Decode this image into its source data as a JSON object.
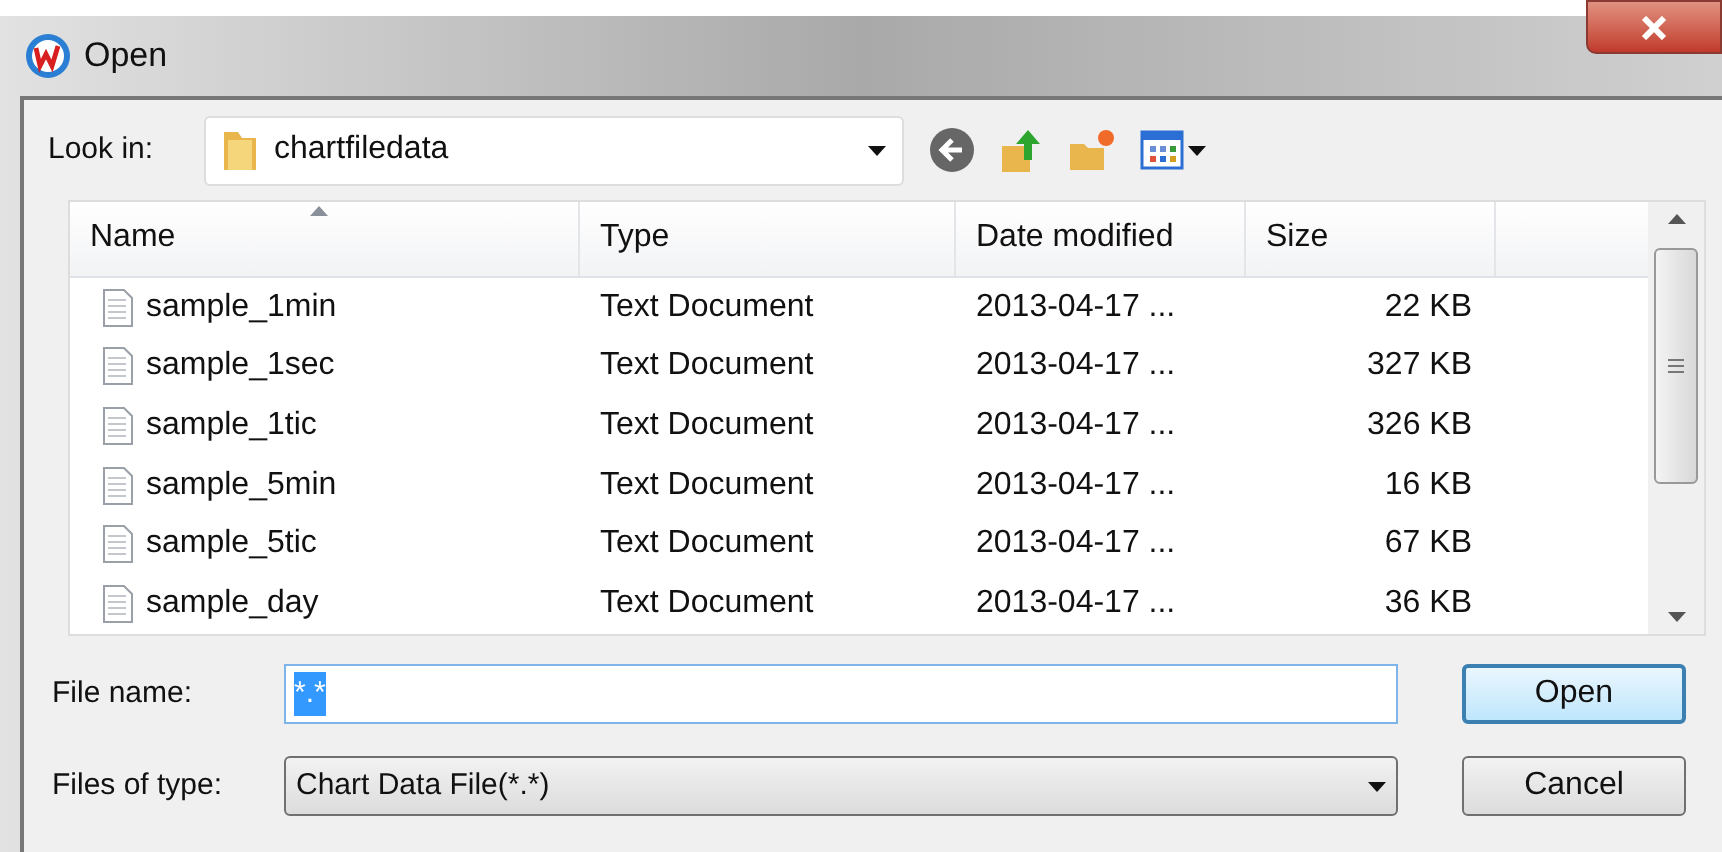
{
  "window": {
    "title": "Open"
  },
  "look_in": {
    "label": "Look in:",
    "value": "chartfiledata"
  },
  "table": {
    "columns": [
      {
        "label": "Name",
        "sorted": true
      },
      {
        "label": "Type",
        "sorted": false
      },
      {
        "label": "Date modified",
        "sorted": false
      },
      {
        "label": "Size",
        "sorted": false
      }
    ],
    "rows": [
      {
        "name": "sample_1min",
        "type": "Text Document",
        "date": "2013-04-17 ...",
        "size": "22 KB"
      },
      {
        "name": "sample_1sec",
        "type": "Text Document",
        "date": "2013-04-17 ...",
        "size": "327 KB"
      },
      {
        "name": "sample_1tic",
        "type": "Text Document",
        "date": "2013-04-17 ...",
        "size": "326 KB"
      },
      {
        "name": "sample_5min",
        "type": "Text Document",
        "date": "2013-04-17 ...",
        "size": "16 KB"
      },
      {
        "name": "sample_5tic",
        "type": "Text Document",
        "date": "2013-04-17 ...",
        "size": "67 KB"
      },
      {
        "name": "sample_day",
        "type": "Text Document",
        "date": "2013-04-17 ...",
        "size": "36 KB"
      }
    ]
  },
  "file_name": {
    "label": "File name:",
    "value": "*.*"
  },
  "file_type": {
    "label": "Files of type:",
    "value": "Chart Data File(*.*)"
  },
  "buttons": [
    {
      "label": "Open",
      "default": true
    },
    {
      "label": "Cancel",
      "default": false
    }
  ]
}
